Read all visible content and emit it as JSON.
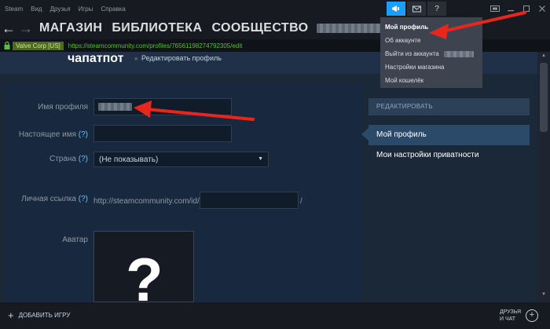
{
  "menu": {
    "items": [
      "Steam",
      "Вид",
      "Друзья",
      "Игры",
      "Справка"
    ]
  },
  "toolbar": {
    "help_label": "?"
  },
  "nav": {
    "links": [
      "МАГАЗИН",
      "БИБЛИОТЕКА",
      "СООБЩЕСТВО"
    ]
  },
  "urlbar": {
    "ev_label": "Valve Corp [US]",
    "url": "https://steamcommunity.com/profiles/76561198274792305/edit"
  },
  "page": {
    "username": "чапатпот",
    "breadcrumb_sep": "»",
    "breadcrumb": "Редактировать профиль"
  },
  "form": {
    "profile_name_label": "Имя профиля",
    "real_name_label": "Настоящее имя",
    "country_label": "Страна",
    "help_mark": "(?)",
    "country_value": "(Не показывать)",
    "custom_url_label": "Личная ссылка",
    "custom_url_prefix": "http://steamcommunity.com/id/",
    "custom_url_suffix": "/",
    "avatar_label": "Аватар",
    "avatar_placeholder": "?"
  },
  "sidenav": {
    "header": "РЕДАКТИРОВАТЬ",
    "items": [
      "Мой профиль",
      "Мои настройки приватности"
    ]
  },
  "dropdown": {
    "items": [
      "Мой профиль",
      "Об аккаунте",
      "Выйти из аккаунта",
      "Настройки магазина",
      "Мой кошелёк"
    ]
  },
  "bottom": {
    "add_game": "ДОБАВИТЬ ИГРУ",
    "friends_line1": "ДРУЗЬЯ",
    "friends_line2": "И ЧАТ"
  },
  "colors": {
    "accent": "#1a9fff",
    "link": "#66c0f4",
    "secure": "#59bf40",
    "annotation": "#e8261c"
  }
}
